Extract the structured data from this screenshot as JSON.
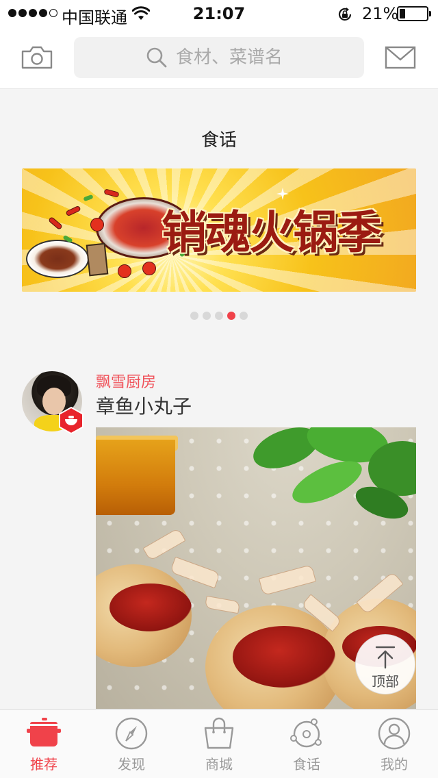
{
  "status_bar": {
    "carrier": "中国联通",
    "time": "21:07",
    "battery_percent": "21%",
    "battery_level": 0.21,
    "signal_bars": 4,
    "signal_total": 5
  },
  "header": {
    "left_icon": "camera-icon",
    "search_placeholder": "食材、菜谱名",
    "right_icon": "mail-icon"
  },
  "section": {
    "title": "食话"
  },
  "banner": {
    "slogan": "销魂火锅季",
    "page_count": 5,
    "active_page": 4
  },
  "feed": {
    "author": "飘雪厨房",
    "title": "章鱼小丸子",
    "badge_icon": "chef-badge-icon"
  },
  "back_to_top": {
    "label": "顶部"
  },
  "tabs": [
    {
      "label": "推荐",
      "icon": "pot-icon",
      "active": true
    },
    {
      "label": "发现",
      "icon": "compass-icon",
      "active": false
    },
    {
      "label": "商城",
      "icon": "shopping-bag-icon",
      "active": false
    },
    {
      "label": "食话",
      "icon": "planet-icon",
      "active": false
    },
    {
      "label": "我的",
      "icon": "user-icon",
      "active": false
    }
  ],
  "colors": {
    "accent": "#f0424a",
    "author": "#f0525a",
    "tab_inactive": "#999999",
    "background": "#f4f4f4"
  }
}
